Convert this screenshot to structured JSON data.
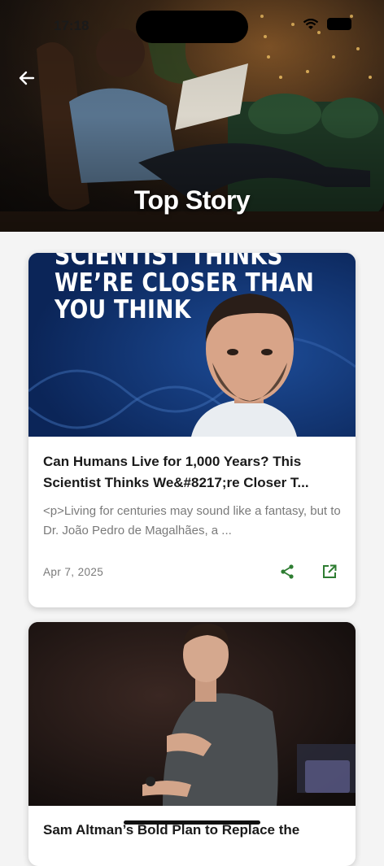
{
  "status_bar": {
    "time": "17:18"
  },
  "header": {
    "title": "Top Story"
  },
  "articles": [
    {
      "image_headline": "SCIENTIST THINKS\nWE’RE CLOSER THAN\nYOU THINK",
      "title": "Can Humans Live for 1,000 Years? This Scientist Thinks We&#8217;re Closer T...",
      "description": "<p>Living for centuries may sound like a fantasy, but to Dr. João Pedro de Magalhães, a ...",
      "date": "Apr 7, 2025"
    },
    {
      "title": "Sam Altman’s Bold Plan to Replace the"
    }
  ],
  "colors": {
    "accent": "#2e7d32",
    "card_image_bg": "#10306a"
  },
  "icons": {
    "back": "arrow-left-icon",
    "share": "share-icon",
    "open": "open-in-new-icon"
  }
}
